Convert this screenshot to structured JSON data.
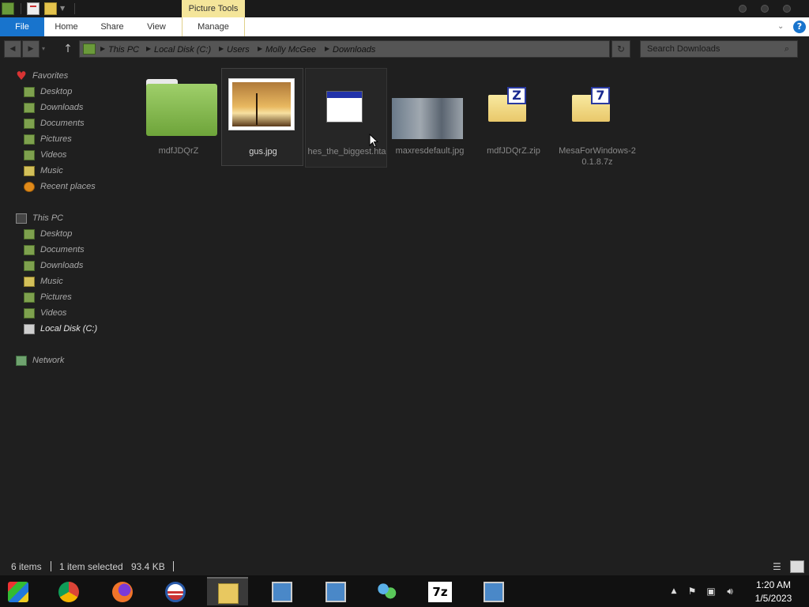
{
  "ribbon": {
    "context_tab": "Picture Tools",
    "tabs": [
      "File",
      "Home",
      "Share",
      "View",
      "Manage"
    ],
    "help": "?"
  },
  "address": {
    "crumbs": [
      "This PC",
      "Local Disk (C:)",
      "Users",
      "Molly McGee",
      "Downloads"
    ]
  },
  "search": {
    "placeholder": "Search Downloads"
  },
  "sidebar": {
    "favorites": {
      "label": "Favorites",
      "items": [
        "Desktop",
        "Downloads",
        "Documents",
        "Pictures",
        "Videos",
        "Music",
        "Recent places"
      ]
    },
    "this_pc": {
      "label": "This PC",
      "items": [
        "Desktop",
        "Documents",
        "Downloads",
        "Music",
        "Pictures",
        "Videos",
        "Local Disk (C:)"
      ],
      "selected": "Local Disk (C:)"
    },
    "network": {
      "label": "Network"
    }
  },
  "files": [
    {
      "name": "mdfJDQrZ",
      "type": "folder-icon"
    },
    {
      "name": "gus.jpg",
      "type": "image-thumbnail",
      "selected": true
    },
    {
      "name": "hes_the_biggest.hta",
      "type": "hta-application-icon"
    },
    {
      "name": "maxresdefault.jpg",
      "type": "image-thumbnail"
    },
    {
      "name": "mdfJDQrZ.zip",
      "type": "zip-archive-icon",
      "badge": "Z"
    },
    {
      "name": "MesaForWindows-20.1.8.7z",
      "type": "7z-archive-icon",
      "badge": "7"
    }
  ],
  "status": {
    "item_count": "6 items",
    "selection": "1 item selected",
    "size": "93.4 KB"
  },
  "taskbar": {
    "items": [
      "start-icon",
      "chrome-icon",
      "firefox-icon",
      "obama-campaign-icon",
      "file-explorer-icon",
      "setup-installer-icon",
      "setup-installer-icon",
      "people-sharing-icon",
      "7zip-icon",
      "setup-installer-icon"
    ],
    "sevenzip_label": "7z",
    "clock_time": "1:20 AM",
    "clock_date": "1/5/2023"
  },
  "colors": {
    "file_tab": "#1874cd",
    "context_tab": "#f4e59a",
    "background": "#1f1f1f",
    "folder_green": "#7ea14e"
  }
}
